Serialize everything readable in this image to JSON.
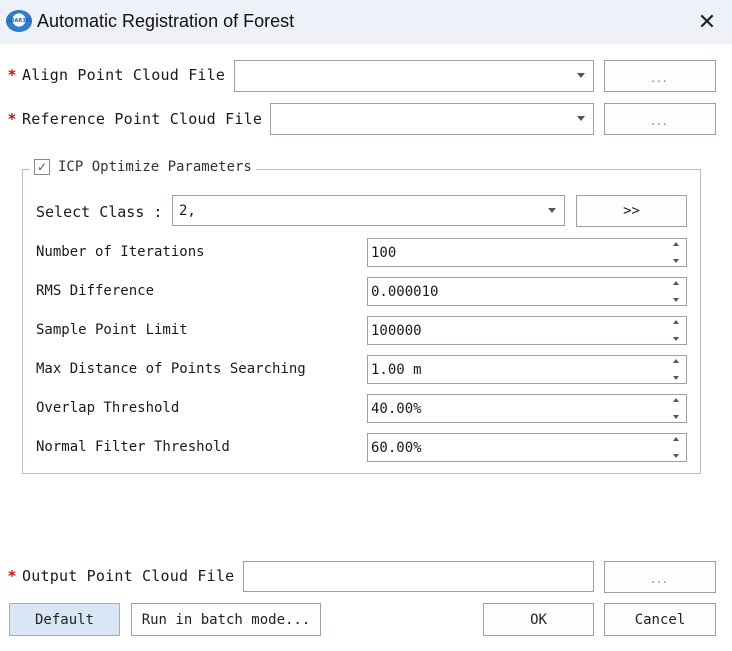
{
  "window": {
    "title": "Automatic Registration of Forest",
    "logo_text": "LIDAR360",
    "close_glyph": "✕"
  },
  "required_marker": "*",
  "align_file": {
    "label": "Align Point Cloud File",
    "value": "",
    "browse_label": "..."
  },
  "reference_file": {
    "label": "Reference Point Cloud File",
    "value": "",
    "browse_label": "..."
  },
  "icp": {
    "enabled": true,
    "check_glyph": "✓",
    "title": "ICP Optimize Parameters",
    "select_class": {
      "label": "Select Class :",
      "value": "2,",
      "button_label": ">>"
    },
    "params": [
      {
        "label": "Number of Iterations",
        "value": "100"
      },
      {
        "label": "RMS Difference",
        "value": "0.000010"
      },
      {
        "label": "Sample Point Limit",
        "value": "100000"
      },
      {
        "label": "Max Distance of Points Searching",
        "value": "1.00 m"
      },
      {
        "label": "Overlap Threshold",
        "value": "40.00%"
      },
      {
        "label": "Normal Filter Threshold",
        "value": "60.00%"
      }
    ]
  },
  "output_file": {
    "label": "Output Point Cloud File",
    "value": "",
    "browse_label": "..."
  },
  "buttons": {
    "default": "Default",
    "batch": "Run in batch mode...",
    "ok": "OK",
    "cancel": "Cancel"
  }
}
